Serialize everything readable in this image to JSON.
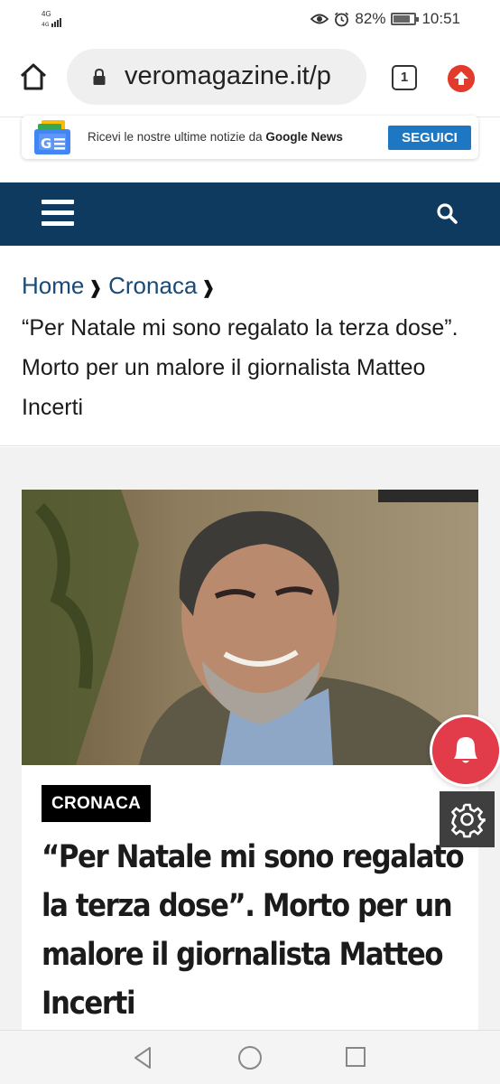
{
  "status_bar": {
    "network": "4G",
    "battery_percent": "82%",
    "battery_level": 0.82,
    "time": "10:51"
  },
  "browser": {
    "url": "veromagazine.it/p",
    "tab_count": "1"
  },
  "google_news_banner": {
    "text_prefix": "Ricevi le nostre ultime notizie da",
    "brand": "Google News",
    "button_label": "SEGUICI"
  },
  "colors": {
    "navbar": "#0e3a5f",
    "link": "#1a4a75",
    "banner_button": "#1e77c2",
    "bell": "#e23c4a"
  },
  "breadcrumb": {
    "home": "Home",
    "category": "Cronaca",
    "current": "“Per Natale mi sono regalato la terza dose”. Morto per un malore il giornalista Matteo Incerti"
  },
  "article": {
    "category_badge": "CRONACA",
    "headline": "“Per Natale mi sono regalato la terza dose”. Morto per un malore il giornalista Matteo Incerti"
  },
  "icons": {
    "menu": "hamburger-icon",
    "search": "search-icon",
    "notifications": "bell-icon",
    "settings": "gear-icon"
  }
}
